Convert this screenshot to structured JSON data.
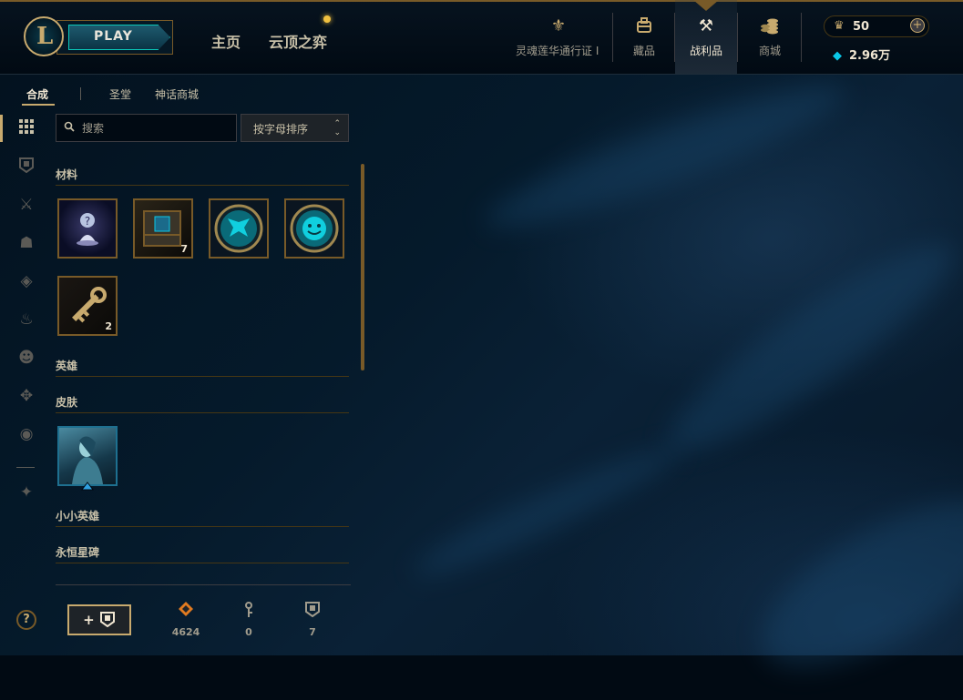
{
  "header": {
    "play_label": "PLAY",
    "nav": [
      {
        "label": "主页"
      },
      {
        "label": "云顶之弈"
      }
    ],
    "right_tabs": [
      {
        "label": "灵魂莲华通行证 I",
        "icon": "lotus-icon"
      },
      {
        "label": "藏品",
        "icon": "backpack-icon"
      },
      {
        "label": "战利品",
        "icon": "loot-icon"
      },
      {
        "label": "商城",
        "icon": "coins-icon"
      }
    ],
    "currency": {
      "rp": "50",
      "be": "2.96万",
      "rp_icon": "rp-icon",
      "be_icon": "blue-essence-icon"
    }
  },
  "subtabs": [
    {
      "label": "合成"
    },
    {
      "label": "圣堂"
    },
    {
      "label": "神话商城"
    }
  ],
  "search": {
    "placeholder": "搜索"
  },
  "sort": {
    "label": "按字母排序"
  },
  "sections": {
    "materials": {
      "title": "材料",
      "items": [
        {
          "count": ""
        },
        {
          "count": "7"
        },
        {
          "count": ""
        },
        {
          "count": ""
        },
        {
          "count": "2"
        }
      ]
    },
    "champions": {
      "title": "英雄"
    },
    "skins": {
      "title": "皮肤"
    },
    "little_legends": {
      "title": "小小英雄"
    },
    "eternals": {
      "title": "永恒星碑"
    }
  },
  "footer": {
    "reroll_label": "+",
    "stats": [
      {
        "value": "4624",
        "icon": "orange-essence-icon"
      },
      {
        "value": "0",
        "icon": "key-fragment-icon"
      },
      {
        "value": "7",
        "icon": "chest-icon"
      }
    ],
    "help_label": "?"
  },
  "colors": {
    "gold": "#c8aa6e",
    "dark_gold": "#785a28",
    "teal": "#0ac8b9",
    "background": "#010a13"
  }
}
